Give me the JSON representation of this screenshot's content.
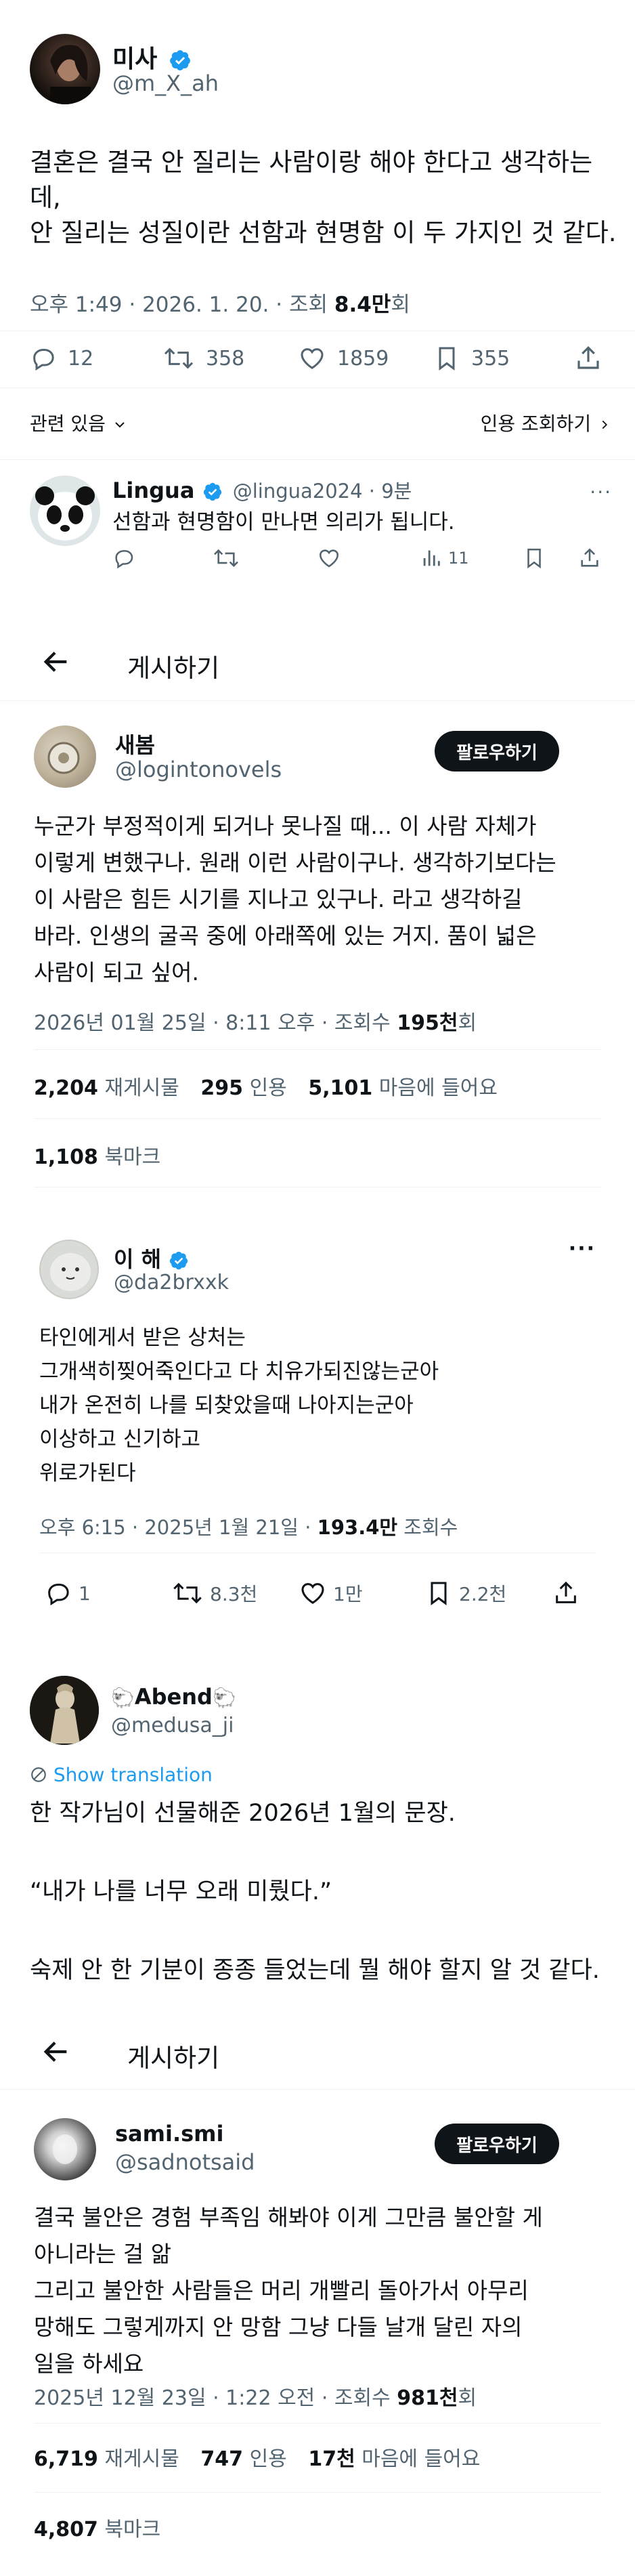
{
  "tweet1": {
    "name": "미사",
    "handle": "@m_X_ah",
    "text_line1": "결혼은 결국 안 질리는 사람이랑 해야 한다고 생각하는",
    "text_line2": "데,",
    "text_line3": "안 질리는 성질이란 선함과 현명함 이 두 가지인 것 같다.",
    "time": "오후 1:49 · 2026. 1. 20. · 조회",
    "views": "8.4만",
    "views_suffix": "회",
    "replies": "12",
    "retweets": "358",
    "likes": "1859",
    "bookmarks": "355",
    "related": "관련 있음",
    "quote_views": "인용 조회하기"
  },
  "reply1": {
    "name": "Lingua",
    "handle": "@lingua2024 · 9분",
    "text": "선함과 현명함이 만나면 의리가 됩니다.",
    "views": "11"
  },
  "post_header1": {
    "title": "게시하기"
  },
  "tweet2": {
    "name": "새봄",
    "handle": "@logintonovels",
    "follow": "팔로우하기",
    "text": "누군가 부정적이게 되거나 못나질 때... 이 사람 자체가\n이렇게 변했구나. 원래 이런 사람이구나. 생각하기보다는\n이 사람은 힘든 시기를 지나고 있구나. 라고 생각하길\n바라. 인생의 굴곡 중에 아래쪽에 있는 거지. 품이 넓은\n사람이 되고 싶어.",
    "time": "2026년 01월 25일 · 8:11 오후 · 조회수",
    "views": "195천",
    "views_suffix": "회",
    "retweets": "2,204",
    "retweets_label": "재게시물",
    "quotes": "295",
    "quotes_label": "인용",
    "likes": "5,101",
    "likes_label": "마음에 들어요",
    "bookmarks": "1,108",
    "bookmarks_label": "북마크"
  },
  "tweet3": {
    "name": "이 해",
    "handle": "@da2brxxk",
    "text": "타인에게서 받은 상처는\n그개색히찢어죽인다고 다 치유가되진않는군아\n내가 온전히 나를 되찾았을때 나아지는군아\n이상하고 신기하고\n위로가된다",
    "time": "오후 6:15 · 2025년 1월 21일 ·",
    "views": "193.4만",
    "views_suffix": "조회수",
    "replies": "1",
    "retweets": "8.3천",
    "likes": "1만",
    "bookmarks": "2.2천"
  },
  "tweet4": {
    "name": "Abend",
    "handle": "@medusa_ji",
    "show_translation": "Show translation",
    "text": "한 작가님이 선물해준 2026년 1월의 문장.\n\n“내가 나를 너무 오래 미뤘다.”\n\n숙제 안 한 기분이 종종 들었는데 뭘 해야 할지 알 것 같다."
  },
  "post_header2": {
    "title": "게시하기"
  },
  "tweet5": {
    "name": "sami.smi",
    "handle": "@sadnotsaid",
    "follow": "팔로우하기",
    "text": "결국 불안은 경험 부족임 해봐야 이게 그만큼 불안할 게\n아니라는 걸 앎\n그리고 불안한 사람들은 머리 개빨리 돌아가서 아무리\n망해도 그렇게까지 안 망함 그냥 다들 날개 달린 자의\n일을 하세요",
    "time": "2025년 12월 23일 · 1:22 오전 · 조회수",
    "views": "981천",
    "views_suffix": "회",
    "retweets": "6,719",
    "retweets_label": "재게시물",
    "quotes": "747",
    "quotes_label": "인용",
    "likes": "17천",
    "likes_label": "마음에 들어요",
    "bookmarks": "4,807",
    "bookmarks_label": "북마크"
  },
  "colors": {
    "accent": "#1d9bf0",
    "text": "#0f1419",
    "muted": "#536471",
    "divider": "#eff3f4"
  }
}
